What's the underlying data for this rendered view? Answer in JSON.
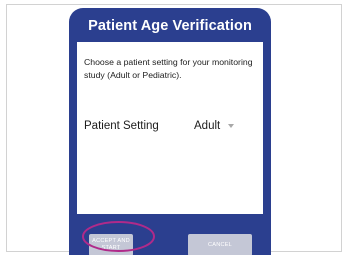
{
  "dialog": {
    "title": "Patient Age Verification",
    "instructions": "Choose a patient setting for your monitoring study (Adult or Pediatric).",
    "setting_label": "Patient Setting",
    "setting_value": "Adult"
  },
  "buttons": {
    "accept_label": "ACCEPT AND START",
    "cancel_label": "CANCEL"
  },
  "colors": {
    "header": "#2b3f8f",
    "button": "#c4c7d6",
    "highlight": "#b02a8a"
  },
  "icons": {
    "dropdown": "chevron-down-icon"
  }
}
